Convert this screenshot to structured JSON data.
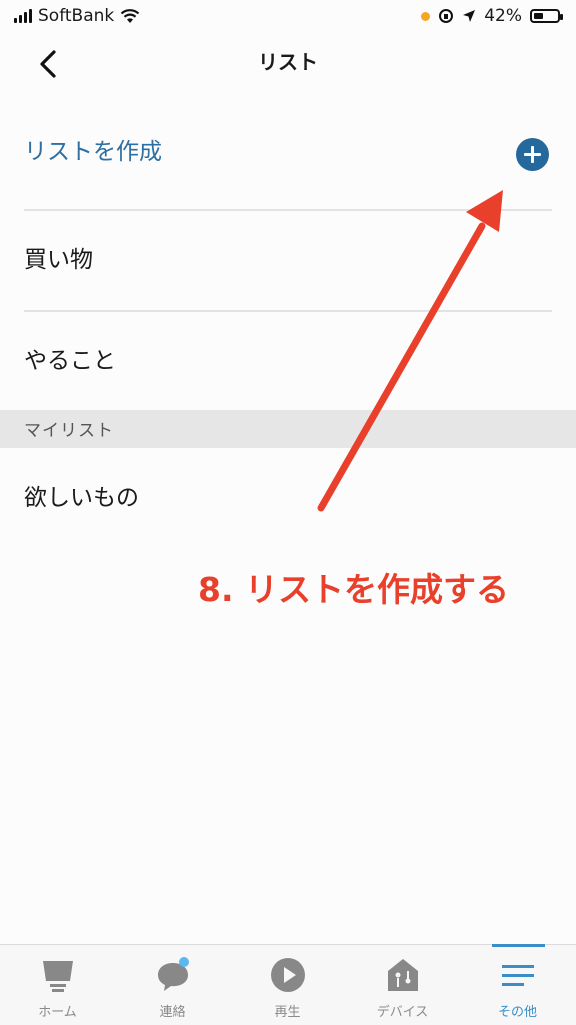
{
  "status_bar": {
    "carrier": "SoftBank",
    "battery": "42%",
    "battery_level": 0.42
  },
  "header": {
    "title": "リスト"
  },
  "create": {
    "label": "リストを作成"
  },
  "lists": [
    "買い物",
    "やること"
  ],
  "section": {
    "label": "マイリスト"
  },
  "my_lists": [
    "欲しいもの"
  ],
  "annotation": {
    "text": "8. リストを作成する",
    "color": "#e8402b"
  },
  "tabs": [
    {
      "label": "ホーム",
      "icon": "home-speaker-icon"
    },
    {
      "label": "連絡",
      "icon": "chat-bubble-icon"
    },
    {
      "label": "再生",
      "icon": "play-icon"
    },
    {
      "label": "デバイス",
      "icon": "devices-home-icon"
    },
    {
      "label": "その他",
      "icon": "menu-icon",
      "active": true
    }
  ],
  "colors": {
    "accent": "#2e6fa3",
    "plus_button": "#24689c",
    "active_tab": "#3a8ec8",
    "notification_dot": "#5ab7f0"
  }
}
